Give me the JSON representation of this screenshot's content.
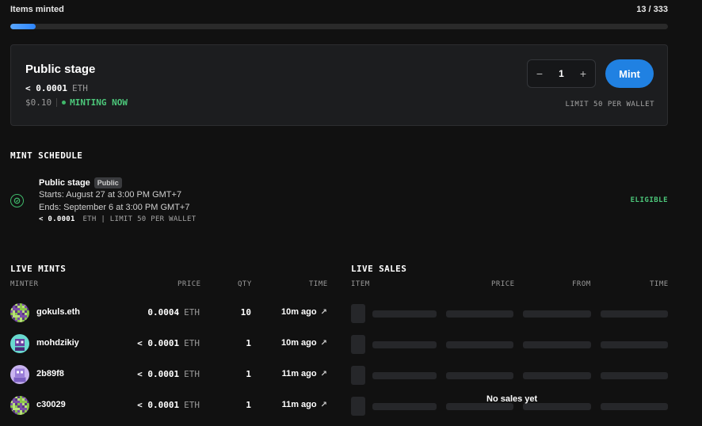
{
  "progress": {
    "label": "Items minted",
    "count": "13 / 333",
    "minted": 13,
    "total": 333,
    "accent": "#2e86ff"
  },
  "stage": {
    "title": "Public stage",
    "price_value": "< 0.0001",
    "price_unit": "ETH",
    "usd": "$0.10",
    "status": "MINTING NOW",
    "quantity": "1",
    "decrement": "−",
    "increment": "+",
    "mint_label": "Mint",
    "limit": "LIMIT 50 PER WALLET"
  },
  "schedule": {
    "title": "MINT SCHEDULE",
    "item": {
      "name": "Public stage",
      "badge": "Public",
      "starts": "Starts: August 27 at 3:00 PM GMT+7",
      "ends": "Ends: September 6 at 3:00 PM GMT+7",
      "price_value": "< 0.0001",
      "meta": "ETH | LIMIT 50 PER WALLET",
      "eligibility": "ELIGIBLE"
    }
  },
  "live_mints": {
    "title": "LIVE MINTS",
    "headers": {
      "minter": "MINTER",
      "price": "PRICE",
      "qty": "QTY",
      "time": "TIME"
    },
    "rows": [
      {
        "minter": "gokuls.eth",
        "price": "0.0004",
        "unit": "ETH",
        "qty": "10",
        "time": "10m ago",
        "avatar": "green-purple-checker"
      },
      {
        "minter": "mohdzikiy",
        "price": "< 0.0001",
        "unit": "ETH",
        "qty": "1",
        "time": "10m ago",
        "avatar": "cyan-robot"
      },
      {
        "minter": "2b89f8",
        "price": "< 0.0001",
        "unit": "ETH",
        "qty": "1",
        "time": "11m ago",
        "avatar": "lavender-robot"
      },
      {
        "minter": "c30029",
        "price": "< 0.0001",
        "unit": "ETH",
        "qty": "1",
        "time": "11m ago",
        "avatar": "green-purple-checker"
      }
    ]
  },
  "live_sales": {
    "title": "LIVE SALES",
    "headers": {
      "item": "ITEM",
      "price": "PRICE",
      "from": "FROM",
      "time": "TIME"
    },
    "empty": "No sales yet"
  }
}
